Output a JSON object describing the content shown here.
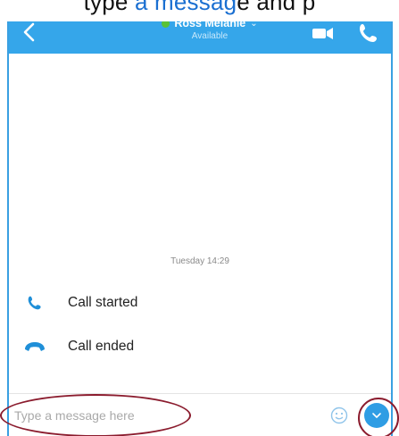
{
  "caption": {
    "before": "ty",
    "middle": "pe",
    "link": "a messag",
    "after": "e and p"
  },
  "header": {
    "contact_name": "Ross Melanie",
    "status": "Available",
    "chevron": "⌄"
  },
  "conversation": {
    "date_separator": "Tuesday 14:29",
    "events": [
      {
        "icon": "call-started-icon",
        "label": "Call started"
      },
      {
        "icon": "call-ended-icon",
        "label": "Call ended"
      }
    ]
  },
  "composer": {
    "placeholder": "Type a message here"
  },
  "colors": {
    "header_bg": "#35a6ea",
    "presence": "#59c236",
    "accent": "#2f9de4",
    "annotation": "#8b1c2e"
  }
}
